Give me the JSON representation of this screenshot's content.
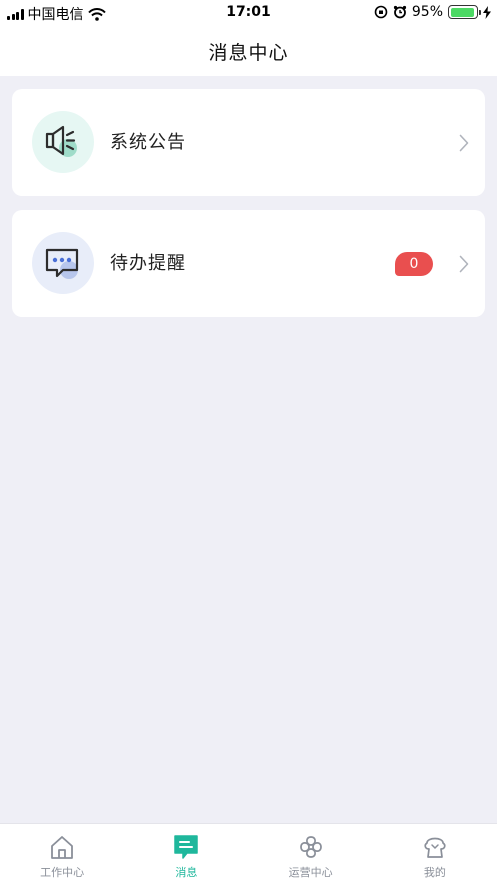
{
  "status_bar": {
    "carrier": "中国电信",
    "time": "17:01",
    "battery_percent": "95%",
    "battery_level": 0.95
  },
  "header": {
    "title": "消息中心"
  },
  "messages": [
    {
      "label": "系统公告",
      "icon": "megaphone-icon"
    },
    {
      "label": "待办提醒",
      "icon": "chat-bubble-icon",
      "badge": "0"
    }
  ],
  "tab_bar": {
    "active_index": 1,
    "accent_color": "#1fb79c",
    "tabs": [
      {
        "label": "工作中心",
        "icon": "home-icon"
      },
      {
        "label": "消息",
        "icon": "message-icon"
      },
      {
        "label": "运营中心",
        "icon": "flower-icon"
      },
      {
        "label": "我的",
        "icon": "profile-icon"
      }
    ]
  }
}
